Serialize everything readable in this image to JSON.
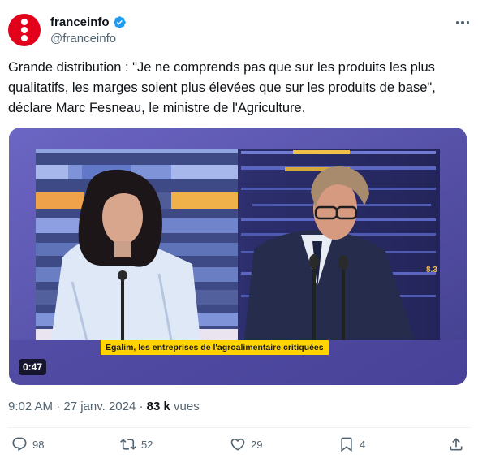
{
  "author": {
    "display_name": "franceinfo",
    "handle": "@franceinfo",
    "verified_icon": "verified-badge-icon",
    "brand_color": "#e2001a"
  },
  "tweet": {
    "text": "Grande distribution : \"Je ne comprends pas que sur les produits les plus qualitatifs, les marges soient plus élevées que sur les produits de base\", déclare Marc Fesneau, le ministre de l'Agriculture."
  },
  "video": {
    "caption": "Egalim, les entreprises de l'agroalimentaire critiquées",
    "duration": "0:47",
    "overlay_number": "8.3"
  },
  "meta": {
    "timestamp": "9:02 AM · 27 janv. 2024 · ",
    "views_count": "83 k",
    "views_label": " vues"
  },
  "actions": {
    "replies": "98",
    "reposts": "52",
    "likes": "29",
    "bookmarks": "4"
  },
  "colors": {
    "text_primary": "#0f1419",
    "text_secondary": "#536471",
    "verified": "#1d9bf0",
    "caption_bg": "#ffd400"
  }
}
